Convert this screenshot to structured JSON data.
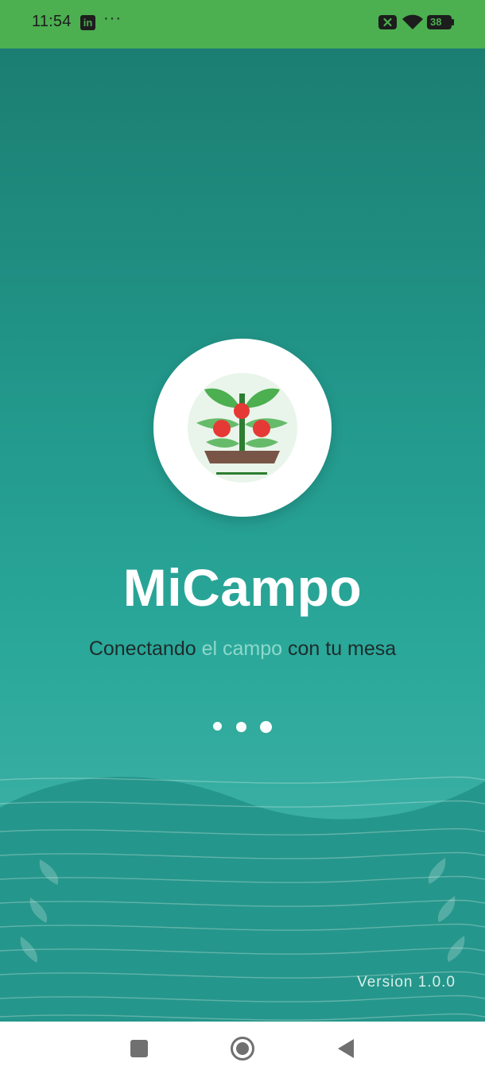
{
  "status_bar": {
    "time": "11:54",
    "linkedin_icon": "linkedin-icon",
    "overflow_dots": "···",
    "battery_level": "38",
    "icons": [
      "linkedin-icon",
      "no-sim-icon",
      "wifi-icon",
      "battery-icon"
    ]
  },
  "splash": {
    "app_title": "MiCampo",
    "tagline_prefix": "Conectando ",
    "tagline_highlight": "el campo",
    "tagline_suffix": " con tu mesa",
    "version": "Version 1.0.0",
    "logo_icon": "tomato-plant-icon",
    "loading_dots": 3
  },
  "nav_bar": {
    "icons": [
      "recent-apps-icon",
      "home-icon",
      "back-icon"
    ]
  },
  "colors": {
    "status_bar_bg": "#4caf50",
    "gradient_top": "#1c7e72",
    "gradient_bottom": "#3aafa3",
    "title": "#ffffff",
    "tagline": "#1e2b2b",
    "tagline_highlight": "#8ed8cb",
    "version_text": "#d8efea"
  }
}
